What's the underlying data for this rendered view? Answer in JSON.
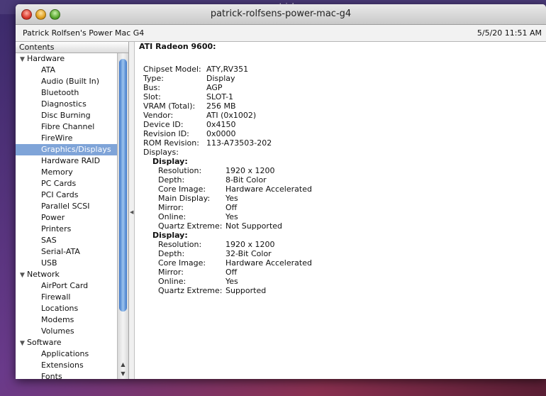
{
  "desktop": {
    "behind_window_title": "patrick"
  },
  "window": {
    "title": "patrick-rolfsens-power-mac-g4"
  },
  "infobar": {
    "computer_name": "Patrick Rolfsen's Power Mac G4",
    "datetime": "5/5/20 11:51 AM"
  },
  "sidebar": {
    "header": "Contents",
    "groups": [
      {
        "label": "Hardware",
        "items": [
          "ATA",
          "Audio (Built In)",
          "Bluetooth",
          "Diagnostics",
          "Disc Burning",
          "Fibre Channel",
          "FireWire",
          "Graphics/Displays",
          "Hardware RAID",
          "Memory",
          "PC Cards",
          "PCI Cards",
          "Parallel SCSI",
          "Power",
          "Printers",
          "SAS",
          "Serial-ATA",
          "USB"
        ]
      },
      {
        "label": "Network",
        "items": [
          "AirPort Card",
          "Firewall",
          "Locations",
          "Modems",
          "Volumes"
        ]
      },
      {
        "label": "Software",
        "items": [
          "Applications",
          "Extensions",
          "Fonts"
        ]
      }
    ],
    "selected": "Graphics/Displays"
  },
  "detail": {
    "title": "ATI Radeon 9600:",
    "properties": [
      {
        "label": "Chipset Model:",
        "value": "ATY,RV351"
      },
      {
        "label": "Type:",
        "value": "Display"
      },
      {
        "label": "Bus:",
        "value": "AGP"
      },
      {
        "label": "Slot:",
        "value": "SLOT-1"
      },
      {
        "label": "VRAM (Total):",
        "value": "256 MB"
      },
      {
        "label": "Vendor:",
        "value": "ATI (0x1002)"
      },
      {
        "label": "Device ID:",
        "value": "0x4150"
      },
      {
        "label": "Revision ID:",
        "value": "0x0000"
      },
      {
        "label": "ROM Revision:",
        "value": "113-A73503-202"
      }
    ],
    "displays_label": "Displays:",
    "displays": [
      {
        "label": "Display:",
        "properties": [
          {
            "label": "Resolution:",
            "value": "1920 x 1200"
          },
          {
            "label": "Depth:",
            "value": "8-Bit Color"
          },
          {
            "label": "Core Image:",
            "value": "Hardware Accelerated"
          },
          {
            "label": "Main Display:",
            "value": "Yes"
          },
          {
            "label": "Mirror:",
            "value": "Off"
          },
          {
            "label": "Online:",
            "value": "Yes"
          },
          {
            "label": "Quartz Extreme:",
            "value": "Not Supported"
          }
        ]
      },
      {
        "label": "Display:",
        "properties": [
          {
            "label": "Resolution:",
            "value": "1920 x 1200"
          },
          {
            "label": "Depth:",
            "value": "32-Bit Color"
          },
          {
            "label": "Core Image:",
            "value": "Hardware Accelerated"
          },
          {
            "label": "Mirror:",
            "value": "Off"
          },
          {
            "label": "Online:",
            "value": "Yes"
          },
          {
            "label": "Quartz Extreme:",
            "value": "Supported"
          }
        ]
      }
    ]
  }
}
